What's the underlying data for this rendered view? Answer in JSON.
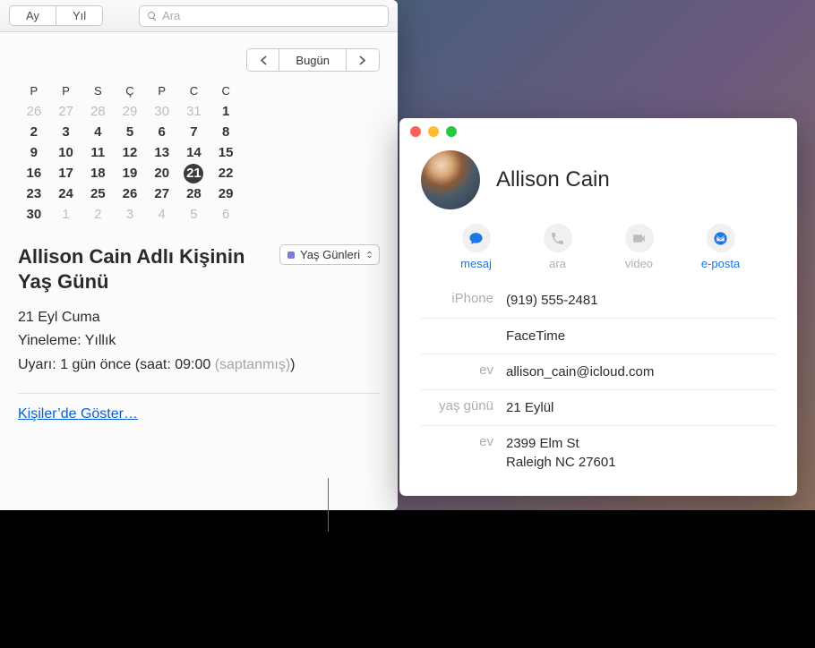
{
  "toolbar": {
    "view_month": "Ay",
    "view_year": "Yıl",
    "search_placeholder": "Ara"
  },
  "nav": {
    "today": "Bugün"
  },
  "calendar": {
    "dow": [
      "P",
      "P",
      "S",
      "Ç",
      "P",
      "C",
      "C"
    ],
    "weeks": [
      [
        {
          "d": "26",
          "m": true
        },
        {
          "d": "27",
          "m": true
        },
        {
          "d": "28",
          "m": true
        },
        {
          "d": "29",
          "m": true
        },
        {
          "d": "30",
          "m": true
        },
        {
          "d": "31",
          "m": true
        },
        {
          "d": "1"
        }
      ],
      [
        {
          "d": "2"
        },
        {
          "d": "3"
        },
        {
          "d": "4"
        },
        {
          "d": "5"
        },
        {
          "d": "6"
        },
        {
          "d": "7"
        },
        {
          "d": "8"
        }
      ],
      [
        {
          "d": "9"
        },
        {
          "d": "10"
        },
        {
          "d": "11"
        },
        {
          "d": "12"
        },
        {
          "d": "13"
        },
        {
          "d": "14"
        },
        {
          "d": "15"
        }
      ],
      [
        {
          "d": "16"
        },
        {
          "d": "17"
        },
        {
          "d": "18"
        },
        {
          "d": "19"
        },
        {
          "d": "20"
        },
        {
          "d": "21",
          "sel": true
        },
        {
          "d": "22"
        }
      ],
      [
        {
          "d": "23"
        },
        {
          "d": "24"
        },
        {
          "d": "25"
        },
        {
          "d": "26"
        },
        {
          "d": "27"
        },
        {
          "d": "28"
        },
        {
          "d": "29"
        }
      ],
      [
        {
          "d": "30"
        },
        {
          "d": "1",
          "m": true
        },
        {
          "d": "2",
          "m": true
        },
        {
          "d": "3",
          "m": true
        },
        {
          "d": "4",
          "m": true
        },
        {
          "d": "5",
          "m": true
        },
        {
          "d": "6",
          "m": true
        }
      ]
    ]
  },
  "event": {
    "title": "Allison Cain Adlı Kişinin Yaş Günü",
    "calendar_name": "Yaş Günleri",
    "date": "21 Eyl Cuma",
    "repeat_label": "Yineleme:",
    "repeat_value": "Yıllık",
    "alert_label": "Uyarı:",
    "alert_value": "1 gün önce (saat: 09:00",
    "alert_default": "(saptanmış)",
    "alert_close": ")",
    "show_in_contacts": "Kişiler’de Göster…"
  },
  "contact": {
    "name": "Allison Cain",
    "actions": {
      "message": "mesaj",
      "call": "ara",
      "video": "video",
      "email": "e-posta"
    },
    "fields": [
      {
        "label": "iPhone",
        "value": "(919) 555-2481"
      },
      {
        "label": "",
        "value": "FaceTime"
      },
      {
        "label": "ev",
        "value": "allison_cain@icloud.com"
      },
      {
        "label": "yaş günü",
        "value": "21 Eylül"
      },
      {
        "label": "ev",
        "value": "2399 Elm St\nRaleigh NC 27601"
      }
    ]
  }
}
